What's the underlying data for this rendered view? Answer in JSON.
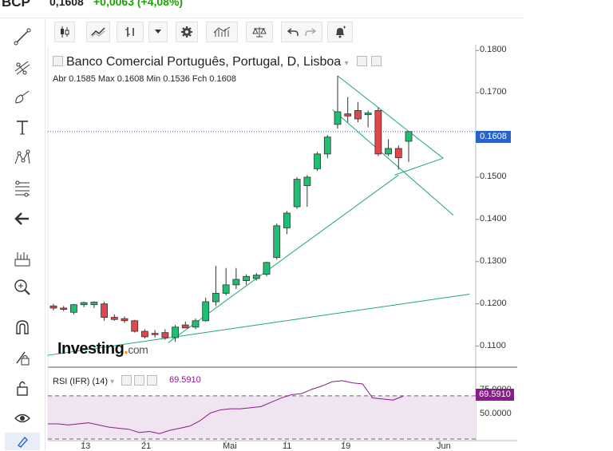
{
  "header": {
    "symbol": "BCP",
    "last_price": "0,1608",
    "change": "+0,0063 (+4,08%)",
    "change_color": "#19a300"
  },
  "toolbar": {
    "buttons": [
      {
        "name": "candlestick-chart-type-icon"
      },
      {
        "name": "line-chart-type-icon"
      },
      {
        "name": "bar-chart-type-icon"
      },
      {
        "name": "dropdown-arrow-icon"
      },
      {
        "name": "settings-gear-icon"
      },
      {
        "name": "indicators-icon"
      },
      {
        "name": "compare-scale-icon"
      },
      {
        "name": "undo-icon"
      },
      {
        "name": "redo-icon"
      },
      {
        "name": "alert-bell-icon"
      }
    ]
  },
  "left_tools": [
    {
      "name": "trend-line-icon"
    },
    {
      "name": "fibonacci-icon"
    },
    {
      "name": "brush-icon"
    },
    {
      "name": "text-tool-icon"
    },
    {
      "name": "pattern-icon"
    },
    {
      "name": "fib-levels-icon"
    },
    {
      "name": "back-arrow-icon"
    },
    {
      "name": "measure-icon"
    },
    {
      "name": "zoom-in-icon"
    },
    {
      "name": "magnet-icon"
    },
    {
      "name": "lock-drawing-icon"
    },
    {
      "name": "lock-icon"
    },
    {
      "name": "eye-visibility-icon"
    },
    {
      "name": "trash-icon"
    }
  ],
  "legend": {
    "title": "Banco Comercial Português, Portugal, D, Lisboa",
    "ohlc": "Abr 0.1585  Max 0.1608  Min 0.1536  Fch 0.1608"
  },
  "rsi": {
    "label": "RSI (IFR) (14)",
    "value": "69.5910",
    "color": "#8a1b8a",
    "tick_75": "75.0000",
    "tick_50": "50.0000"
  },
  "price_badge": "0.1608",
  "price_badge_color": "#2a62c9",
  "logo": {
    "main": "Investing",
    "dot": ".",
    "tld": "com"
  },
  "chart_data": {
    "type": "candlestick",
    "y_ticks": [
      "0.1800",
      "0.1700",
      "0.1500",
      "0.1400",
      "0.1300",
      "0.1200",
      "0.1100"
    ],
    "x_ticks": [
      "13",
      "21",
      "Mai",
      "11",
      "19",
      "Jun"
    ],
    "ylim": [
      0.105,
      0.181
    ],
    "up_color": "#1fbf73",
    "down_color": "#e0464b",
    "candles": [
      {
        "o": 0.1195,
        "h": 0.12,
        "l": 0.1185,
        "c": 0.119
      },
      {
        "o": 0.119,
        "h": 0.1195,
        "l": 0.1183,
        "c": 0.1187
      },
      {
        "o": 0.118,
        "h": 0.12,
        "l": 0.1175,
        "c": 0.1198
      },
      {
        "o": 0.1198,
        "h": 0.1205,
        "l": 0.1192,
        "c": 0.1203
      },
      {
        "o": 0.1198,
        "h": 0.1206,
        "l": 0.119,
        "c": 0.1204
      },
      {
        "o": 0.12,
        "h": 0.1205,
        "l": 0.116,
        "c": 0.1168
      },
      {
        "o": 0.1168,
        "h": 0.1175,
        "l": 0.116,
        "c": 0.1163
      },
      {
        "o": 0.1165,
        "h": 0.117,
        "l": 0.1155,
        "c": 0.116
      },
      {
        "o": 0.116,
        "h": 0.1162,
        "l": 0.1132,
        "c": 0.1135
      },
      {
        "o": 0.1135,
        "h": 0.114,
        "l": 0.1118,
        "c": 0.1122
      },
      {
        "o": 0.113,
        "h": 0.1138,
        "l": 0.112,
        "c": 0.1128
      },
      {
        "o": 0.1132,
        "h": 0.114,
        "l": 0.1115,
        "c": 0.112
      },
      {
        "o": 0.112,
        "h": 0.115,
        "l": 0.111,
        "c": 0.1145
      },
      {
        "o": 0.115,
        "h": 0.1158,
        "l": 0.1145,
        "c": 0.1143
      },
      {
        "o": 0.1145,
        "h": 0.1165,
        "l": 0.114,
        "c": 0.116
      },
      {
        "o": 0.116,
        "h": 0.1215,
        "l": 0.1158,
        "c": 0.1205
      },
      {
        "o": 0.1205,
        "h": 0.129,
        "l": 0.1195,
        "c": 0.1225
      },
      {
        "o": 0.1225,
        "h": 0.1285,
        "l": 0.122,
        "c": 0.1245
      },
      {
        "o": 0.1245,
        "h": 0.1285,
        "l": 0.1235,
        "c": 0.1258
      },
      {
        "o": 0.1255,
        "h": 0.127,
        "l": 0.1245,
        "c": 0.1265
      },
      {
        "o": 0.126,
        "h": 0.1273,
        "l": 0.1255,
        "c": 0.1268
      },
      {
        "o": 0.127,
        "h": 0.13,
        "l": 0.1265,
        "c": 0.1298
      },
      {
        "o": 0.131,
        "h": 0.139,
        "l": 0.1305,
        "c": 0.1385
      },
      {
        "o": 0.138,
        "h": 0.142,
        "l": 0.1365,
        "c": 0.1415
      },
      {
        "o": 0.143,
        "h": 0.15,
        "l": 0.1425,
        "c": 0.1495
      },
      {
        "o": 0.148,
        "h": 0.1505,
        "l": 0.143,
        "c": 0.15
      },
      {
        "o": 0.152,
        "h": 0.156,
        "l": 0.1515,
        "c": 0.1555
      },
      {
        "o": 0.1555,
        "h": 0.16,
        "l": 0.1545,
        "c": 0.1595
      },
      {
        "o": 0.1625,
        "h": 0.174,
        "l": 0.1615,
        "c": 0.1655
      },
      {
        "o": 0.165,
        "h": 0.169,
        "l": 0.163,
        "c": 0.1645
      },
      {
        "o": 0.1658,
        "h": 0.1678,
        "l": 0.163,
        "c": 0.1638
      },
      {
        "o": 0.1648,
        "h": 0.1658,
        "l": 0.1618,
        "c": 0.1652
      },
      {
        "o": 0.1658,
        "h": 0.1665,
        "l": 0.155,
        "c": 0.1555
      },
      {
        "o": 0.1555,
        "h": 0.159,
        "l": 0.155,
        "c": 0.1568
      },
      {
        "o": 0.1568,
        "h": 0.1575,
        "l": 0.1518,
        "c": 0.1546
      },
      {
        "o": 0.1585,
        "h": 0.1608,
        "l": 0.1536,
        "c": 0.1608
      }
    ],
    "rsi_ylim": [
      30,
      95
    ],
    "rsi_values": [
      44,
      44,
      43,
      44,
      45,
      43,
      41,
      40,
      39,
      36,
      37,
      35,
      38,
      40,
      42,
      47,
      54,
      57,
      58,
      58,
      59,
      60,
      64,
      68,
      71,
      72,
      76,
      79,
      83,
      84,
      82,
      81,
      68,
      67,
      66,
      69.6
    ]
  }
}
